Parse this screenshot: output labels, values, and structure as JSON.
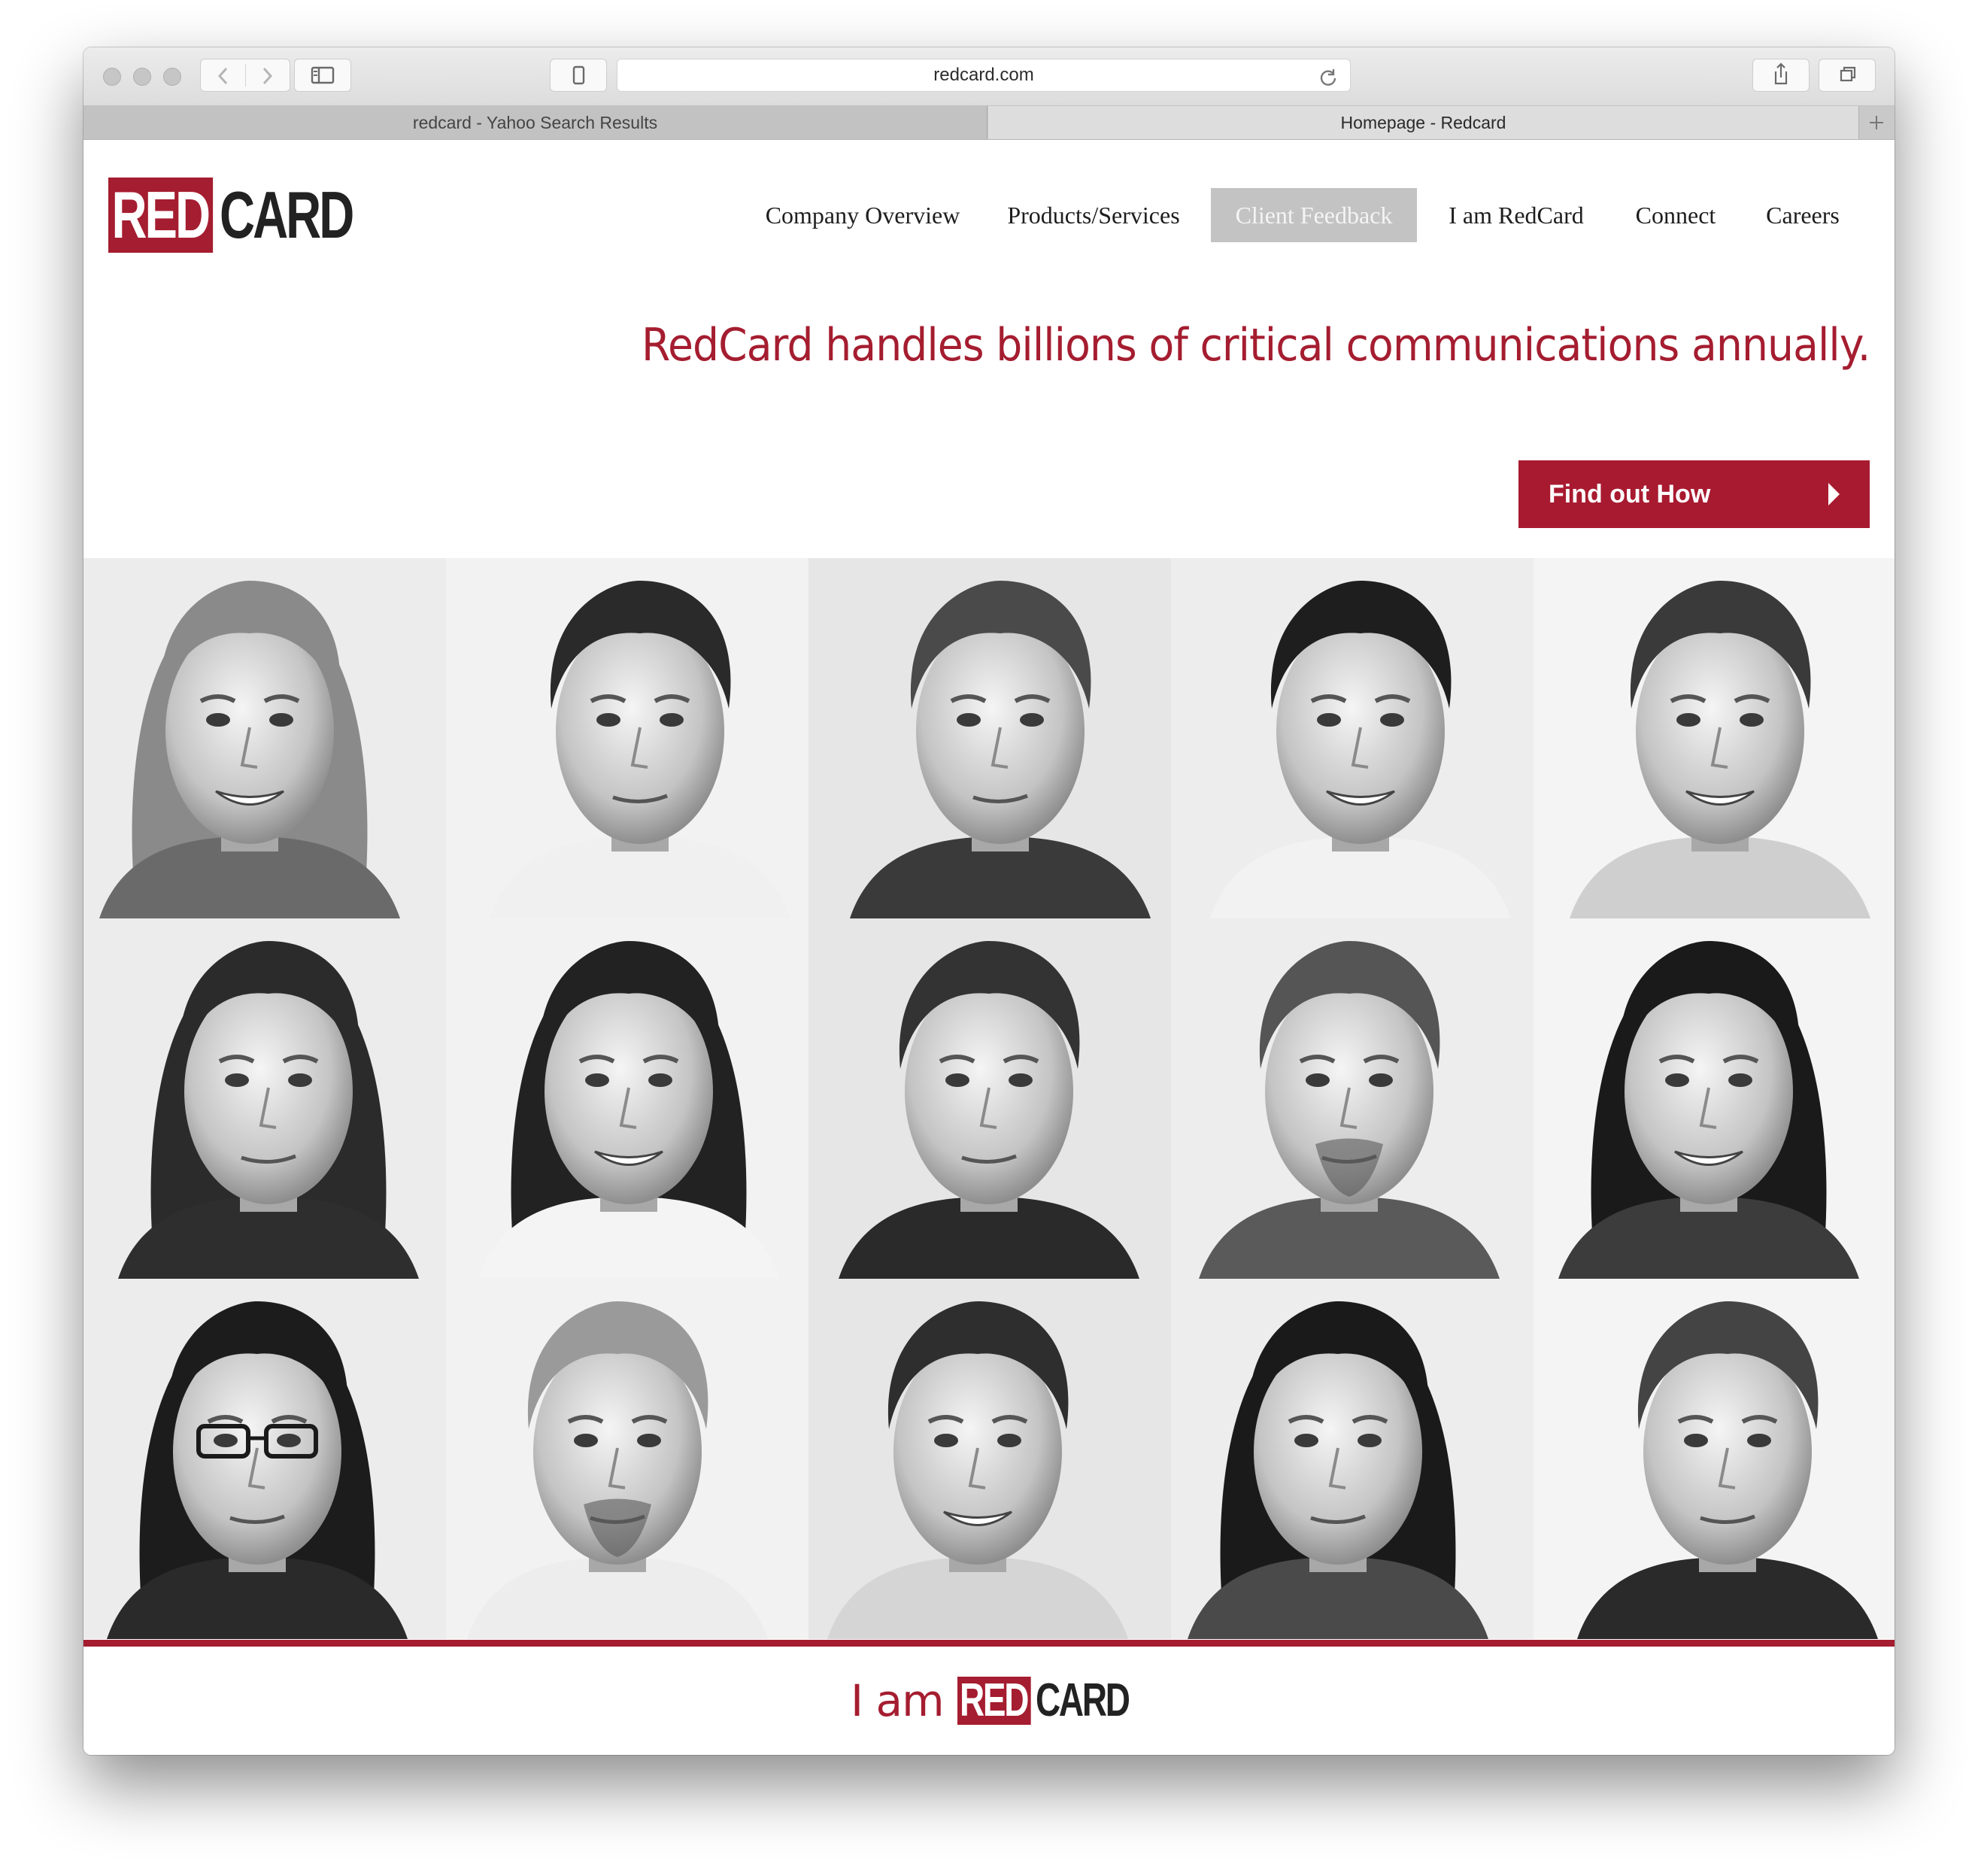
{
  "browser": {
    "url": "redcard.com",
    "tabs": [
      {
        "title": "redcard - Yahoo Search Results",
        "active": false
      },
      {
        "title": "Homepage - Redcard",
        "active": true
      }
    ],
    "icons": {
      "back": "chevron-left-icon",
      "forward": "chevron-right-icon",
      "sidebar": "sidebar-icon",
      "reader": "phone-icon",
      "reload": "reload-icon",
      "share": "share-icon",
      "tabs": "tabs-overview-icon",
      "new_tab": "plus-icon"
    }
  },
  "site": {
    "logo": {
      "red_part": "RED",
      "dark_part": "CARD"
    },
    "nav": [
      {
        "label": "Company Overview",
        "active": false
      },
      {
        "label": "Products/Services",
        "active": false
      },
      {
        "label": "Client Feedback",
        "active": true
      },
      {
        "label": "I am RedCard",
        "active": false
      },
      {
        "label": "Connect",
        "active": false
      },
      {
        "label": "Careers",
        "active": false
      }
    ],
    "headline": "RedCard handles billions of critical communications annually.",
    "cta": {
      "label": "Find out How",
      "icon": "play-arrow-icon"
    },
    "footer_tag": {
      "prefix": "I am",
      "red_part": "RED",
      "dark_part": "CARD"
    },
    "colors": {
      "brand_red": "#a51d30",
      "active_nav_bg": "#c3c3c3"
    }
  }
}
